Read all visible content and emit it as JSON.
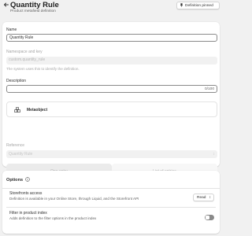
{
  "header": {
    "title": "Quantity Rule",
    "subtitle": "Product metafield definition",
    "pin_button": "Definition pinned",
    "back_icon": "arrow-left-icon",
    "pin_icon": "pin-icon"
  },
  "form": {
    "name_label": "Name",
    "name_value": "Quantity Rule",
    "namespace_label": "Namespace and key",
    "namespace_value": "custom.quantity_rule",
    "namespace_help": "The system uses this to identify the definition.",
    "description_label": "Description",
    "description_value": "",
    "description_counter": "0/100",
    "type_button": "Metaobject",
    "type_icon": "metaobject-icon",
    "reference_label": "Reference",
    "reference_value": "Quantity Rule",
    "seg_one": "One entry",
    "seg_list": "List of entries"
  },
  "options": {
    "title": "Options",
    "info_icon": "info-icon",
    "storefront_title": "Storefronts access",
    "storefront_desc": "Definition is available in your Online Store, through Liquid, and the Storefront API",
    "storefront_value": "Read",
    "filter_title": "Filter in product index",
    "filter_desc": "Adds definition to the filter options in the product index",
    "filter_enabled": false
  },
  "colors": {
    "page_bg": "#f1f1f1",
    "card_bg": "#ffffff",
    "toggle_off": "#8a8a8a"
  }
}
